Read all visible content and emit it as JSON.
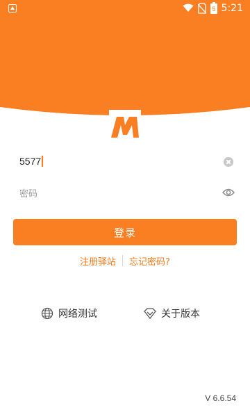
{
  "status_bar": {
    "time": "5:21",
    "battery_level": "5",
    "icons": [
      "notification-icon",
      "wifi-icon",
      "no-sim-icon",
      "battery-icon"
    ]
  },
  "theme": {
    "accent": "#fa7e22",
    "link": "#f07a1c",
    "background": "#ffffff"
  },
  "logo": {
    "letter": "M",
    "icon": "m-logo-icon"
  },
  "form": {
    "account_value": "5577",
    "password_placeholder": "密码",
    "clear_icon": "clear-icon",
    "eye_icon": "eye-icon"
  },
  "login_button": {
    "label": "登录"
  },
  "links": {
    "register": "注册驿站",
    "forgot_password": "忘记密码?"
  },
  "bottom": {
    "network_test": "网络测试",
    "network_icon": "globe-icon",
    "about_version": "关于版本",
    "about_icon": "diamond-icon"
  },
  "version": "V 6.6.54"
}
